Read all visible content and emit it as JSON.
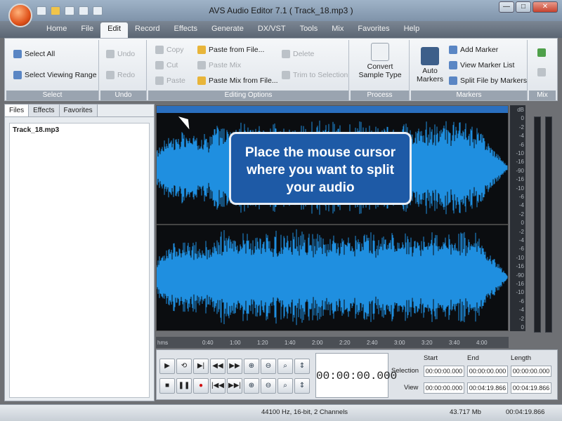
{
  "window": {
    "title": "AVS Audio Editor 7.1  ( Track_18.mp3 )",
    "minimize": "—",
    "maximize": "□",
    "close": "✕"
  },
  "menu": [
    "Home",
    "File",
    "Edit",
    "Record",
    "Effects",
    "Generate",
    "DX/VST",
    "Tools",
    "Mix",
    "Favorites",
    "Help"
  ],
  "ribbon": {
    "select": {
      "label": "Select",
      "select_all": "Select All",
      "select_viewing_range": "Select Viewing Range"
    },
    "undo": {
      "label": "Undo",
      "undo": "Undo",
      "redo": "Redo"
    },
    "editing": {
      "label": "Editing Options",
      "copy": "Copy",
      "cut": "Cut",
      "paste": "Paste",
      "paste_from_file": "Paste from File...",
      "paste_mix": "Paste Mix",
      "paste_mix_from_file": "Paste Mix from File...",
      "delete": "Delete",
      "trim": "Trim to Selection"
    },
    "process": {
      "label": "Process",
      "convert": "Convert Sample Type"
    },
    "markers": {
      "label": "Markers",
      "auto": "Auto Markers",
      "add": "Add Marker",
      "view_list": "View Marker List",
      "split": "Split File by Markers"
    },
    "mix": {
      "label": "Mix"
    }
  },
  "left_panel": {
    "tabs": [
      "Files",
      "Effects",
      "Favorites"
    ],
    "files": [
      "Track_18.mp3"
    ]
  },
  "tooltip": {
    "line1": "Place the mouse cursor",
    "line2": "where you want to split",
    "line3": "your audio"
  },
  "db_ruler": [
    "dB",
    "0",
    "-2",
    "-4",
    "-6",
    "-10",
    "-16",
    "-90",
    "-16",
    "-10",
    "-6",
    "-4",
    "-2",
    "0",
    "-2",
    "-4",
    "-6",
    "-10",
    "-16",
    "-90",
    "-16",
    "-10",
    "-6",
    "-4",
    "-2",
    "0"
  ],
  "timeline": {
    "labels": [
      "hms",
      "0:40",
      "1:00",
      "1:20",
      "1:40",
      "2:00",
      "2:20",
      "2:40",
      "3:00",
      "3:20",
      "3:40",
      "4:00"
    ]
  },
  "transport": {
    "play": "▶",
    "loop": "⟲",
    "play_sel": "▶|",
    "rewind": "◀◀",
    "ffwd": "▶▶",
    "stop": "■",
    "pause": "❚❚",
    "record": "●",
    "start": "|◀◀",
    "end": "▶▶|"
  },
  "timecode": "00:00:00.000",
  "selection": {
    "headers": {
      "start": "Start",
      "end": "End",
      "length": "Length"
    },
    "rows": [
      {
        "label": "Selection",
        "start": "00:00:00.000",
        "end": "00:00:00.000",
        "length": "00:00:00.000"
      },
      {
        "label": "View",
        "start": "00:00:00.000",
        "end": "00:04:19.866",
        "length": "00:04:19.866"
      }
    ]
  },
  "status": {
    "format": "44100 Hz, 16-bit, 2 Channels",
    "size": "43.717 Mb",
    "duration": "00:04:19.866"
  },
  "colors": {
    "waveform": "#1f8fe0",
    "tooltip": "#1e5aa6",
    "background": "#0b0d10"
  }
}
